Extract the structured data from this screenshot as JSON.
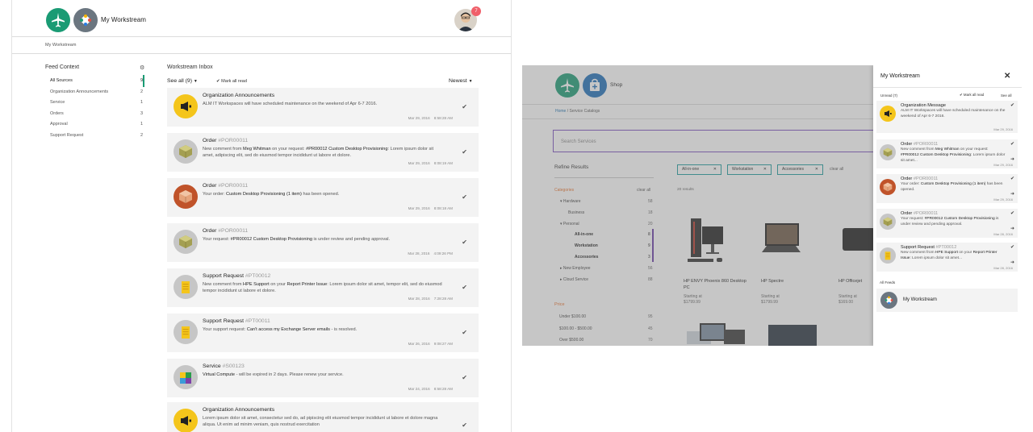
{
  "left": {
    "app_title": "My Workstream",
    "notification_count": "7",
    "breadcrumb": "My Workstream",
    "feed_context": {
      "title": "Feed Context",
      "items": [
        {
          "label": "All Sources",
          "count": "9"
        },
        {
          "label": "Organization Announcements",
          "count": "2"
        },
        {
          "label": "Service",
          "count": "1"
        },
        {
          "label": "Orders",
          "count": "3"
        },
        {
          "label": "Approval",
          "count": "1"
        },
        {
          "label": "Support Request",
          "count": "2"
        }
      ]
    },
    "inbox": {
      "title": "Workstream Inbox",
      "see_all": "See all (9)",
      "mark_all_read": "Mark all read",
      "sort": "Newest",
      "cards": [
        {
          "title": "Organization Announcements",
          "num": "",
          "msg": [
            "ALM IT Workspaces will have scheduled maintenance on the weekend of Apr 6-7 2016."
          ],
          "date": "Mar 29, 2016",
          "time": "8:58:28 AM"
        },
        {
          "title": "Order",
          "num": "#POR00011",
          "msg": [
            "New comment from ",
            "Meg Whitman",
            " on your request: ",
            "#PR00012 Custom Desktop Provisioning",
            ": Lorem ipsum dolor sit amet, adipiscing elit, sed do eiusmod tempor incididunt ut labore et dolore."
          ],
          "date": "Mar 29, 2016",
          "time": "8:08:19 AM"
        },
        {
          "title": "Order",
          "num": "#POR00011",
          "msg": [
            "Your order: ",
            "Custom Desktop Provisioning (1 item)",
            " has been opened."
          ],
          "date": "Mar 29, 2016",
          "time": "8:08:18 AM"
        },
        {
          "title": "Order",
          "num": "#POR00011",
          "msg": [
            "Your request: ",
            "#PR00012 Custom Desktop Provisioning",
            " is under review and pending approval."
          ],
          "date": "Mar 28, 2016",
          "time": "4:09:26 PM"
        },
        {
          "title": "Support Request",
          "num": "#PT00012",
          "msg": [
            "New comment from ",
            "HPE Support",
            " on your ",
            "Report Printer Issue",
            ": Lorem ipsum dolor sit amet, tempor elit, sed do eiusmod tempor incididunt ut labore et dolore."
          ],
          "date": "Mar 28, 2016",
          "time": "7:28:28 AM"
        },
        {
          "title": "Support Request",
          "num": "#PT00011",
          "msg": [
            "Your support request: ",
            "Can't access my Exchange Server emails",
            " - is resolved."
          ],
          "date": "Mar 26, 2016",
          "time": "9:08:27 AM"
        },
        {
          "title": "Service",
          "num": "#S00123",
          "msg": [
            "",
            "Virtual Compute",
            " - will be expired in 2 days. Please renew your service."
          ],
          "date": "Mar 24, 2016",
          "time": "8:58:28 AM"
        },
        {
          "title": "Organization Announcements",
          "num": "",
          "msg": [
            "Lorem ipsum dolor sit amet, consectetur sed do, ad pipiscing elit eiusmod tempor incididunt ut labore et dolore magna aliqua. Ut enim ad minim veniam, quis nostrud exercitation"
          ],
          "date": "",
          "time": ""
        }
      ]
    }
  },
  "right": {
    "shop_label": "Shop",
    "breadcrumb": [
      "Home",
      "Service Catalogs"
    ],
    "search_placeholder": "Search Services",
    "refine_title": "Refine Results",
    "chips": [
      "All-in-one",
      "Workstation",
      "Accessories"
    ],
    "clear_all": "clear all",
    "results_count": "20 results",
    "categories_title": "Categories",
    "categories": [
      {
        "label": "Hardware",
        "count": "58"
      },
      {
        "label": "Business",
        "count": "18"
      },
      {
        "label": "Personal",
        "count": "20"
      },
      {
        "label": "All-in-one",
        "count": "8"
      },
      {
        "label": "Workstation",
        "count": "9"
      },
      {
        "label": "Accessories",
        "count": "3"
      },
      {
        "label": "New Employee",
        "count": "56"
      },
      {
        "label": "Cloud Service",
        "count": "88"
      }
    ],
    "price_title": "Price",
    "prices": [
      {
        "label": "Under $100.00",
        "count": "95"
      },
      {
        "label": "$100.00 - $500.00",
        "count": "45"
      },
      {
        "label": "Over $500.00",
        "count": "70"
      }
    ],
    "products": [
      {
        "name": "HP ENVY Phoenix 860 Desktop PC",
        "starting": "Starting at",
        "price": "$1799.99"
      },
      {
        "name": "HP Spectre",
        "starting": "Starting at",
        "price": "$1799.99"
      },
      {
        "name": "HP Officejet",
        "starting": "Starting at",
        "price": "$169.00"
      }
    ],
    "panel": {
      "title": "My Workstream",
      "unread": "Unread (7)",
      "mark_all_read": "Mark all read",
      "see_all": "See all",
      "cards": [
        {
          "title": "Organization Message",
          "num": "",
          "msg": [
            "ALM IT Workspaces will have scheduled maintenance on the weekend of Apr 6-7 2016."
          ],
          "date": "Mar 29, 2016"
        },
        {
          "title": "Order",
          "num": "#POR00011",
          "msg": [
            "New comment from ",
            "Meg Whitman",
            " on your request: ",
            "#PR00012 Custom Desktop Provisioning",
            ": Lorem ipsum dolor sit amet..."
          ],
          "date": "Mar 29, 2016"
        },
        {
          "title": "Order",
          "num": "#POR00011",
          "msg": [
            "Your order: ",
            "Custom Desktop Provisioning (1 item)",
            " has been opened."
          ],
          "date": "Mar 29, 2016"
        },
        {
          "title": "Order",
          "num": "#POR00011",
          "msg": [
            "Your request: ",
            "#PR00012 Custom Desktop Provisioning",
            " is under review and pending approval."
          ],
          "date": "Mar 28, 2016"
        },
        {
          "title": "Support Request",
          "num": "#PT00012",
          "msg": [
            "New comment from ",
            "HPE Support",
            " on your ",
            "Report Printer Issue",
            ": Lorem ipsum dolor sit amet..."
          ],
          "date": "Mar 28, 2016"
        }
      ],
      "all_feeds": "All Feeds",
      "feed_name": "My Workstream"
    }
  },
  "colors": {
    "accent": "#1a9b74",
    "teal": "#1a9b9e",
    "purple": "#6a3da8",
    "orange": "#e8702a",
    "badge": "#f0606a"
  }
}
